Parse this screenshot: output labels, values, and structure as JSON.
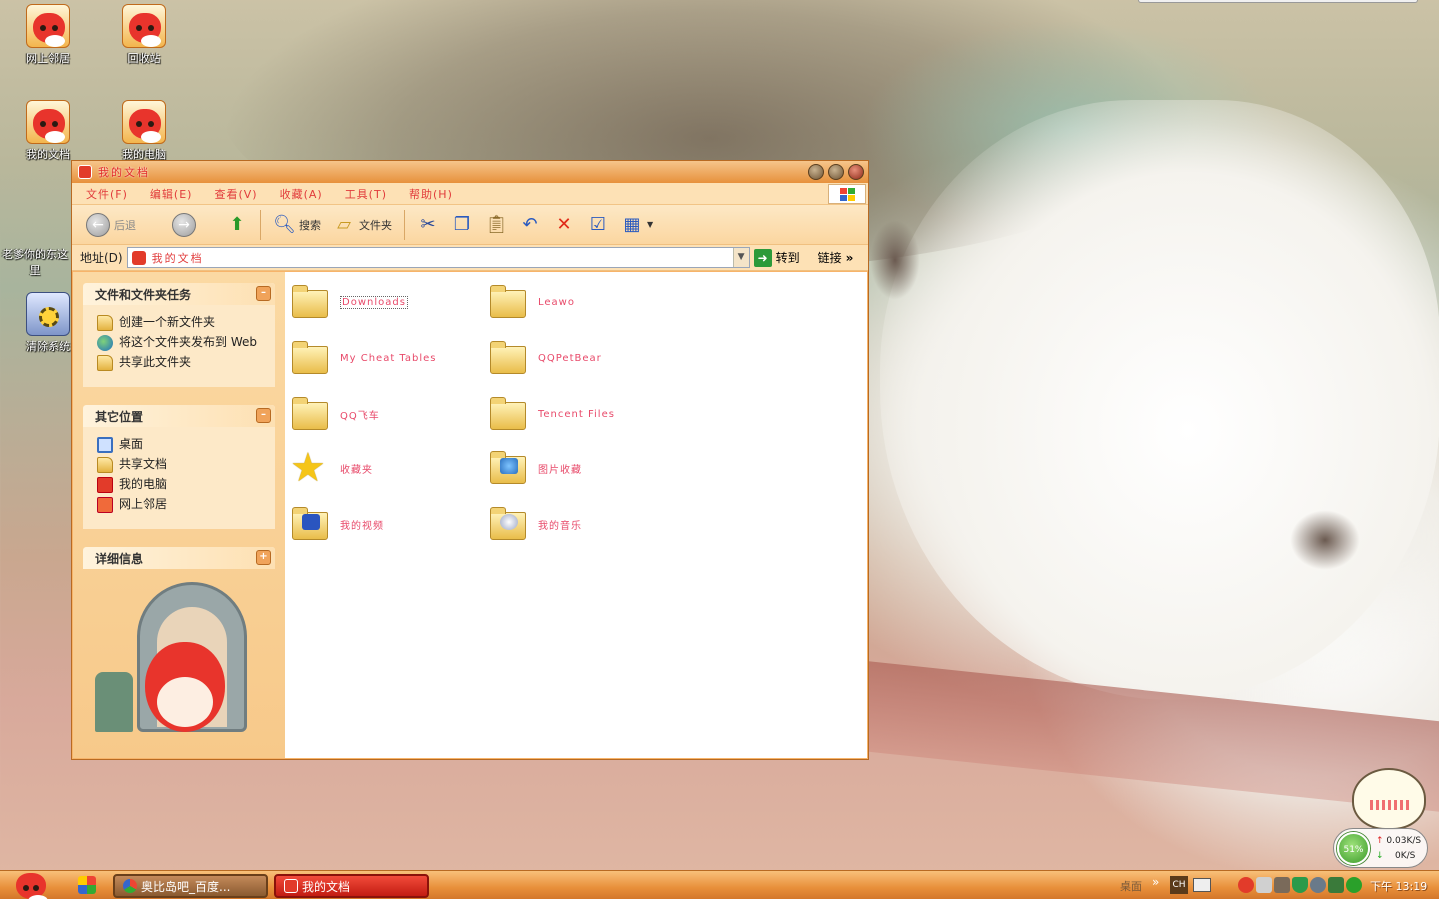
{
  "desktop": {
    "icons": [
      {
        "label": "网上邻居",
        "icon": "network-fox-icon"
      },
      {
        "label": "回收站",
        "icon": "recycle-fox-icon"
      },
      {
        "label": "我的文档",
        "icon": "documents-fox-icon"
      },
      {
        "label": "我的电脑",
        "icon": "computer-fox-icon"
      },
      {
        "label": "老爹你的东这里",
        "icon": "shortcut-text"
      },
      {
        "label": "清除系统",
        "icon": "gear-program-icon"
      }
    ]
  },
  "window": {
    "title": "我的文档",
    "menu": [
      "文件(F)",
      "编辑(E)",
      "查看(V)",
      "收藏(A)",
      "工具(T)",
      "帮助(H)"
    ],
    "toolbar": {
      "back_label": "后退",
      "search_label": "搜索",
      "folders_label": "文件夹"
    },
    "address": {
      "label": "地址(D)",
      "value": "我的文档",
      "go_label": "转到",
      "links_label": "链接"
    },
    "taskpane": {
      "file_tasks": {
        "title": "文件和文件夹任务",
        "items": [
          "创建一个新文件夹",
          "将这个文件夹发布到 Web",
          "共享此文件夹"
        ]
      },
      "other_places": {
        "title": "其它位置",
        "items": [
          "桌面",
          "共享文档",
          "我的电脑",
          "网上邻居"
        ]
      },
      "details": {
        "title": "详细信息"
      }
    },
    "files": [
      {
        "name": "Downloads",
        "type": "folder",
        "selected": true
      },
      {
        "name": "Leawo",
        "type": "folder"
      },
      {
        "name": "My Cheat Tables",
        "type": "folder"
      },
      {
        "name": "QQPetBear",
        "type": "folder"
      },
      {
        "name": "QQ飞车",
        "type": "folder"
      },
      {
        "name": "Tencent Files",
        "type": "folder"
      },
      {
        "name": "收藏夹",
        "type": "favorites"
      },
      {
        "name": "图片收藏",
        "type": "pictures"
      },
      {
        "name": "我的视频",
        "type": "videos"
      },
      {
        "name": "我的音乐",
        "type": "music"
      }
    ]
  },
  "taskbar": {
    "tasks": [
      {
        "label": "奥比岛吧_百度..."
      },
      {
        "label": "我的文档",
        "active": true
      }
    ],
    "tray_label": "桌面",
    "ime": "CH",
    "clock": "下午 13:19"
  },
  "netmonitor": {
    "percent": "51%",
    "up": "0.03K/S",
    "down": "0K/S"
  }
}
